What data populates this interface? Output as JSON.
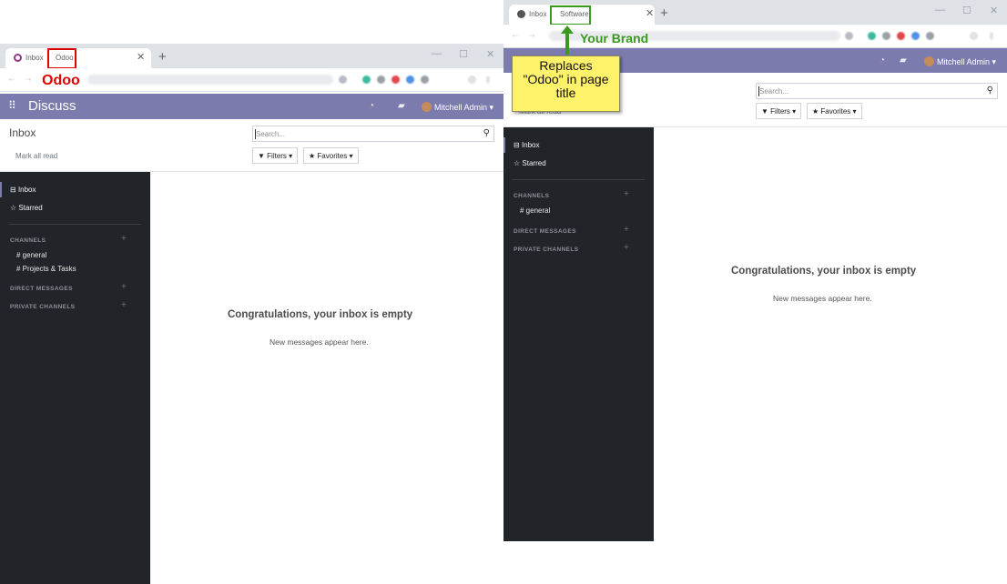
{
  "before": {
    "tab": {
      "title_prefix": "Inbox",
      "title_suffix": "Odoo"
    },
    "annotation_label": "Odoo",
    "navbar": {
      "app_name": "Discuss",
      "user_name": "Mitchell Admin"
    },
    "control_panel": {
      "breadcrumb": "Inbox",
      "mark_all_read": "Mark all read",
      "search_placeholder": "Search...",
      "filters_label": "Filters",
      "favorites_label": "Favorites"
    },
    "sidebar": {
      "inbox": "Inbox",
      "starred": "Starred",
      "channels_header": "CHANNELS",
      "channels": [
        "# general",
        "# Projects & Tasks"
      ],
      "direct_messages_header": "DIRECT MESSAGES",
      "private_channels_header": "PRIVATE CHANNELS"
    },
    "empty": {
      "title": "Congratulations, your inbox is empty",
      "subtitle": "New messages appear here."
    }
  },
  "after": {
    "tab": {
      "title_prefix": "Inbox",
      "title_suffix": "Software"
    },
    "brand_label": "Your Brand",
    "callout_lines": [
      "Replaces",
      "\"Odoo\" in page",
      "title"
    ],
    "navbar": {
      "user_name": "Mitchell Admin"
    },
    "control_panel": {
      "mark_all_read": "Mark all read",
      "search_placeholder": "Search...",
      "filters_label": "Filters",
      "favorites_label": "Favorites"
    },
    "sidebar": {
      "inbox": "Inbox",
      "starred": "Starred",
      "channels_header": "CHANNELS",
      "channels": [
        "# general"
      ],
      "direct_messages_header": "DIRECT MESSAGES",
      "private_channels_header": "PRIVATE CHANNELS"
    },
    "empty": {
      "title": "Congratulations, your inbox is empty",
      "subtitle": "New messages appear here."
    }
  },
  "colors": {
    "navbar": "#7c7bad",
    "sidebar": "#212529",
    "highlight_red": "#e00000",
    "highlight_green": "#3a9a1e",
    "callout": "#fff26b"
  },
  "icons": {
    "apps_menu": "grid-icon",
    "search": "search-icon",
    "filters": "filter-icon",
    "favorites": "star-icon",
    "inbox": "inbox-icon",
    "starred": "star-outline-icon",
    "add_channel": "plus-icon"
  }
}
